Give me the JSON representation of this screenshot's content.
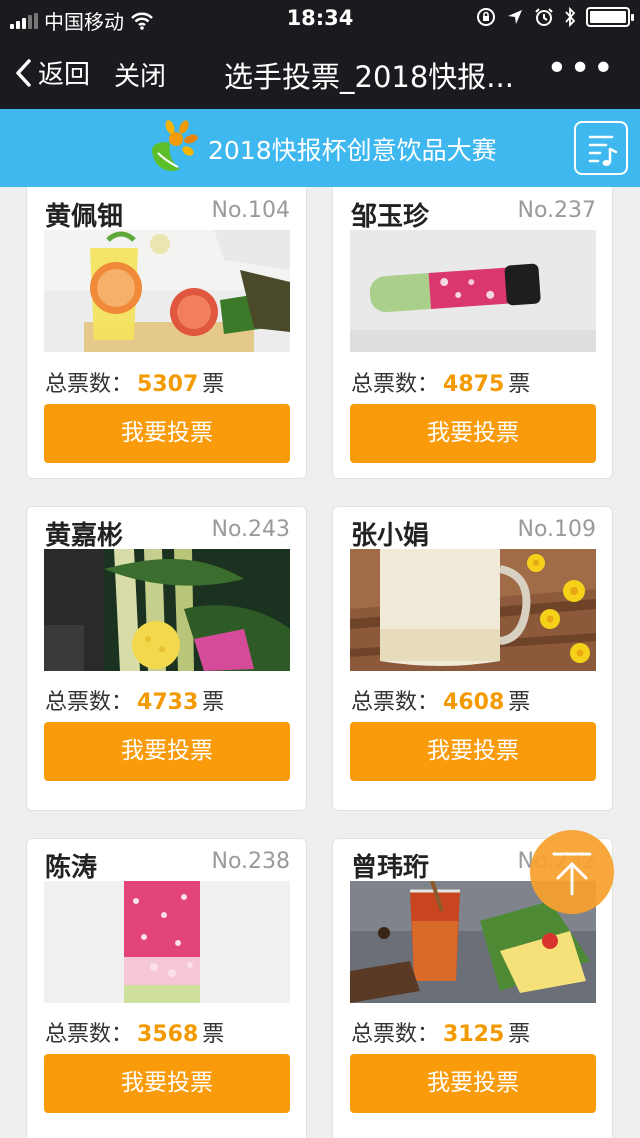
{
  "status_bar": {
    "carrier": "中国移动",
    "time": "18:34"
  },
  "nav": {
    "back_label": "返回",
    "close_label": "关闭",
    "title": "选手投票_2018快报...",
    "more_label": "•••"
  },
  "banner": {
    "title": "2018快报杯创意饮品大赛"
  },
  "labels": {
    "vote_prefix": "总票数：",
    "vote_unit": "票"
  },
  "contestants": [
    {
      "name": "黄佩钿",
      "number": "No.104",
      "votes": "5307",
      "button": "我要投票"
    },
    {
      "name": "邹玉珍",
      "number": "No.237",
      "votes": "4875",
      "button": "我要投票"
    },
    {
      "name": "黄嘉彬",
      "number": "No.243",
      "votes": "4733",
      "button": "我要投票"
    },
    {
      "name": "张小娟",
      "number": "No.109",
      "votes": "4608",
      "button": "我要投票"
    },
    {
      "name": "陈涛",
      "number": "No.238",
      "votes": "3568",
      "button": "我要投票"
    },
    {
      "name": "曾玮珩",
      "number": "No.232",
      "votes": "3125",
      "button": "我要投票"
    }
  ],
  "colors": {
    "accent": "#f99b0a",
    "vote_count": "#f39a00",
    "banner": "#3fb8ef",
    "navbar": "#1b1b1f"
  }
}
